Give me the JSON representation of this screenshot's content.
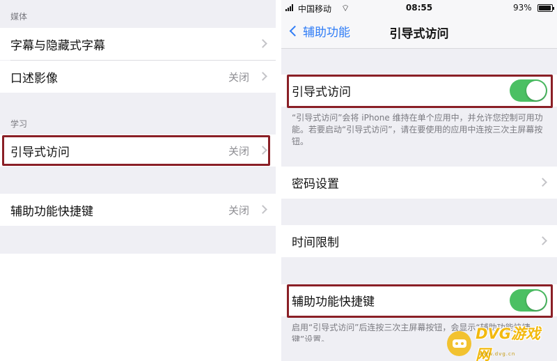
{
  "left": {
    "sections": [
      {
        "header": "媒体",
        "rows": [
          {
            "label": "字幕与隐藏式字幕",
            "value": ""
          },
          {
            "label": "口述影像",
            "value": "关闭"
          }
        ]
      },
      {
        "header": "学习",
        "rows": [
          {
            "label": "引导式访问",
            "value": "关闭"
          }
        ]
      },
      {
        "header": "",
        "rows": [
          {
            "label": "辅助功能快捷键",
            "value": "关闭"
          }
        ]
      }
    ]
  },
  "right": {
    "status": {
      "carrier": "中国移动",
      "time": "08:55",
      "battery": "93%",
      "battery_level": 0.93
    },
    "nav": {
      "back_label": "辅助功能",
      "title": "引导式访问"
    },
    "guided_access": {
      "label": "引导式访问",
      "on": true,
      "footer": "“引导式访问”会将 iPhone 维持在单个应用中，并允许您控制可用功能。若要启动“引导式访问”，请在要使用的应用中连按三次主屏幕按钮。"
    },
    "passcode_settings": {
      "label": "密码设置"
    },
    "time_limits": {
      "label": "时间限制"
    },
    "accessibility_shortcut": {
      "label": "辅助功能快捷键",
      "on": true,
      "footer": "启用“引导式访问”后连按三次主屏幕按钮，会显示“辅助功能快捷键”设置。"
    }
  },
  "watermark": {
    "text": "DVG游戏网",
    "subtext": "www.dvg.cn"
  },
  "colors": {
    "highlight": "#8a1f26",
    "ios_blue": "#2f7cf6",
    "toggle_on": "#4bc063",
    "group_bg": "#efeff4"
  }
}
